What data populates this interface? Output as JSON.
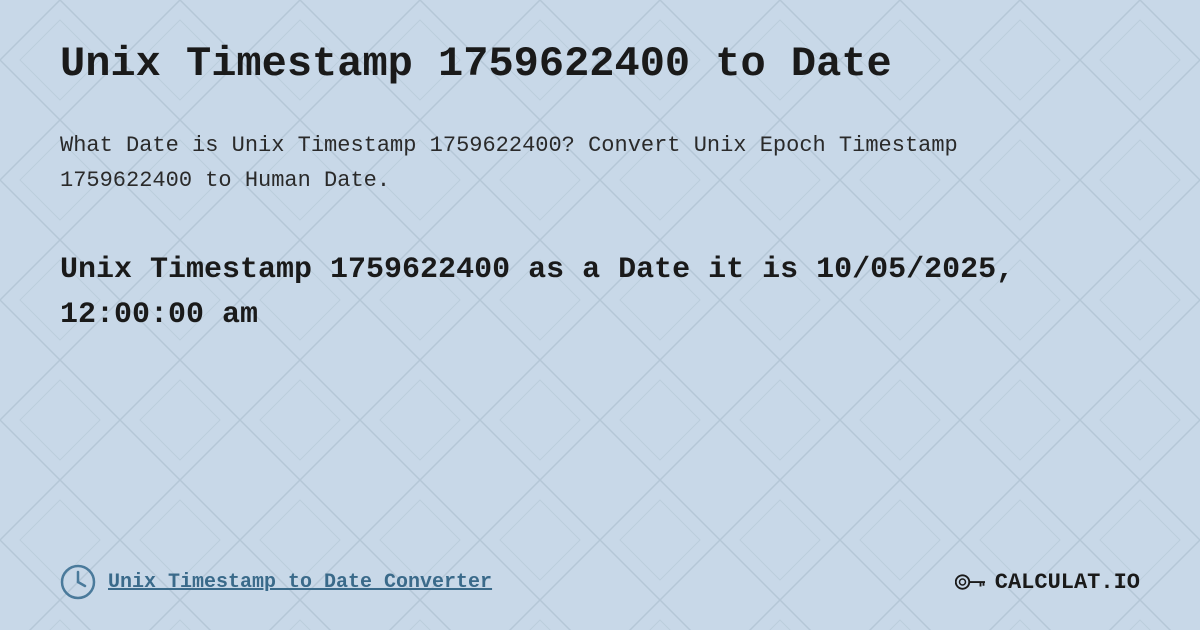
{
  "page": {
    "title": "Unix Timestamp 1759622400 to Date",
    "description": "What Date is Unix Timestamp 1759622400? Convert Unix Epoch Timestamp 1759622400 to Human Date.",
    "result": "Unix Timestamp 1759622400 as a Date it is 10/05/2025, 12:00:00 am",
    "footer_link": "Unix Timestamp to Date Converter",
    "logo_text": "CALCULAT.IO"
  },
  "colors": {
    "bg": "#c8d8e8",
    "bg_diamond": "#b8ccd8",
    "title_color": "#1a1a1a",
    "desc_color": "#2a2a2a",
    "result_color": "#1a1a1a",
    "link_color": "#3a6a8a",
    "logo_color": "#1a1a1a"
  }
}
